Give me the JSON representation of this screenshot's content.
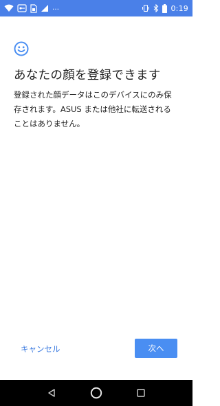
{
  "status_bar": {
    "time": "0:19",
    "overflow_dots": "…",
    "left_icons": [
      "wifi-icon",
      "vpn-key-icon",
      "sim-icon",
      "signal-icon"
    ],
    "right_icons": [
      "vibrate-icon",
      "bluetooth-icon",
      "battery-icon"
    ]
  },
  "screen": {
    "icon": "face-icon",
    "title": "あなたの顔を登録できます",
    "description": "登録された顔データはこのデバイスにのみ保存されます。ASUS または他社に転送されることはありません。"
  },
  "actions": {
    "cancel_label": "キャンセル",
    "next_label": "次へ"
  },
  "nav_bar": {
    "buttons": [
      "back-icon",
      "home-icon",
      "recents-icon"
    ]
  },
  "colors": {
    "status_bar": "#4a80e8",
    "accent": "#4a8ef2",
    "link": "#3b7ae0",
    "nav_bar": "#000000"
  }
}
